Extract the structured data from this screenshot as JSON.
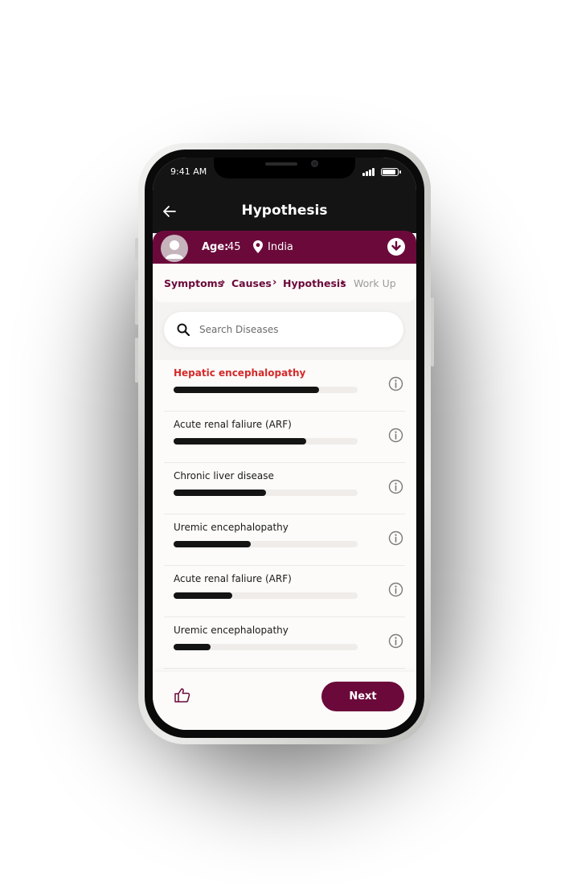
{
  "status_bar": {
    "time": "9:41 AM"
  },
  "header": {
    "title": "Hypothesis"
  },
  "patient": {
    "age_label": "Age:",
    "age_value": "45",
    "location": "India"
  },
  "breadcrumb": {
    "steps": [
      {
        "label": "Symptoms",
        "active": true
      },
      {
        "label": "Causes",
        "active": true
      },
      {
        "label": "Hypothesis",
        "active": true
      },
      {
        "label": "Work Up",
        "active": false
      }
    ]
  },
  "search": {
    "placeholder": "Search Diseases",
    "value": ""
  },
  "diseases": [
    {
      "name": "Hepatic encephalopathy",
      "score": 0.79,
      "highlighted": true
    },
    {
      "name": "Acute renal faliure (ARF)",
      "score": 0.72,
      "highlighted": false
    },
    {
      "name": "Chronic liver disease",
      "score": 0.5,
      "highlighted": false
    },
    {
      "name": "Uremic encephalopathy",
      "score": 0.42,
      "highlighted": false
    },
    {
      "name": "Acute renal faliure (ARF)",
      "score": 0.32,
      "highlighted": false
    },
    {
      "name": "Uremic encephalopathy",
      "score": 0.2,
      "highlighted": false
    }
  ],
  "footer": {
    "next_label": "Next"
  },
  "colors": {
    "brand": "#6b0a3a",
    "highlight": "#d42a2a",
    "bar": "#141414",
    "track": "#efecea"
  },
  "icons": [
    "back-arrow-icon",
    "avatar-icon",
    "location-pin-icon",
    "download-icon",
    "search-icon",
    "info-icon",
    "thumbs-up-icon"
  ]
}
